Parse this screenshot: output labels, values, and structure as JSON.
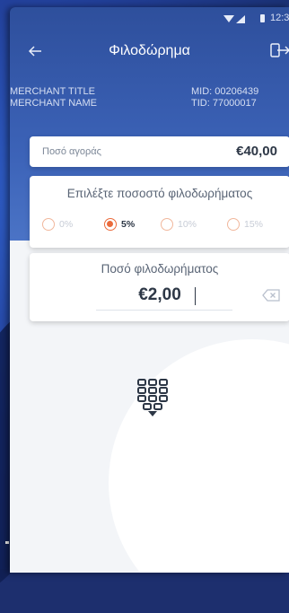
{
  "status_bar": {
    "time": "12:3"
  },
  "app_bar": {
    "back_icon": "arrow-left-icon",
    "title": "Φιλοδώρημα",
    "exit_icon": "exit-icon"
  },
  "merchant": {
    "title": "MERCHANT TITLE",
    "name": "MERCHANT NAME",
    "mid": "MID: 00206439",
    "tid": "TID: 77000017"
  },
  "purchase": {
    "label": "Ποσό αγοράς",
    "value": "€40,00"
  },
  "percentage": {
    "label": "Επιλέξτε ποσοστό φιλοδωρήματος",
    "options": [
      {
        "label": "0%",
        "selected": false
      },
      {
        "label": "5%",
        "selected": true
      },
      {
        "label": "10%",
        "selected": false
      },
      {
        "label": "15%",
        "selected": false
      }
    ]
  },
  "tip": {
    "label": "Ποσό φιλοδωρήματος",
    "value": "€2,00",
    "clear_icon": "backspace-icon"
  },
  "keypad": {
    "icon": "keypad-toggle-icon"
  },
  "colors": {
    "accent": "#ea6b3c",
    "header": "#3c63b8",
    "text_dark": "#2d3746"
  }
}
